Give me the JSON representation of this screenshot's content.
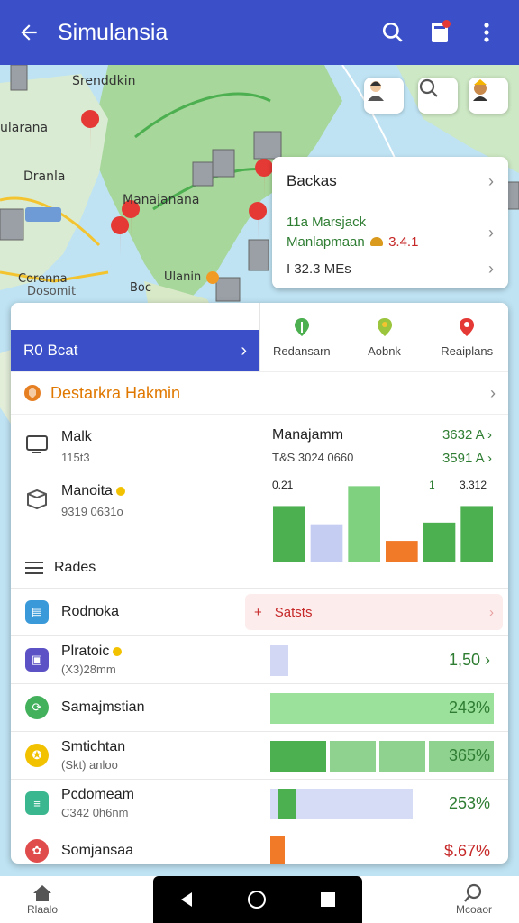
{
  "app": {
    "title": "Simulansia"
  },
  "map": {
    "labels": [
      "Srenddkin",
      "ularana",
      "Dranla",
      "Manajanana",
      "Corenna",
      "Dosomit",
      "Ulanin",
      "Boc"
    ],
    "chips": [
      "avatar-icon",
      "search-icon",
      "avatar2-icon"
    ]
  },
  "infocard": {
    "title": "Backas",
    "line1": "11a Marsjack",
    "line2": "Manlapmaan",
    "line2_val": "3.4.1",
    "line3": "I 32.3 MEs"
  },
  "panel": {
    "tab_active": "R0 Bcat",
    "tabs": [
      "Redansarn",
      "Aobnk",
      "Reaiplans"
    ],
    "section": "Destarkra Hakmin",
    "items": [
      {
        "name": "Malk",
        "sub": "115t3"
      },
      {
        "name": "Manoita",
        "sub": "9319 0631o"
      }
    ],
    "stats": {
      "title": "Manajamm",
      "sub": "T&S 3024 0660",
      "v1": "3632 A",
      "v2": "3591 A",
      "bar_labels": [
        "0.21",
        "1",
        "3.312"
      ]
    },
    "rates_label": "Rades",
    "rows": [
      {
        "name": "Rodnoka",
        "sub": "",
        "status": "Satsts",
        "value": ""
      },
      {
        "name": "Plratoic",
        "sub": "(X3)28mm",
        "value": "1,50"
      },
      {
        "name": "Samajmstian",
        "sub": "",
        "value": "243%"
      },
      {
        "name": "Smtichtan",
        "sub": "(Skt) anloo",
        "value": "365%"
      },
      {
        "name": "Pcdomeam",
        "sub": "C342 0h6nm",
        "value": "253%"
      },
      {
        "name": "Somjansaa",
        "sub": "",
        "value": "$.67%"
      }
    ]
  },
  "chart_data": {
    "type": "bar",
    "categories": [
      "1",
      "2",
      "3",
      "4",
      "5",
      "6"
    ],
    "values": [
      68,
      46,
      92,
      26,
      48,
      68
    ],
    "colors": [
      "#4caf50",
      "#c5cdf3",
      "#7fd07f",
      "#f07a28",
      "#4caf50",
      "#4caf50"
    ],
    "ylim": [
      0,
      100
    ]
  },
  "bottom_nav": {
    "left": "Rlaalo",
    "right": "Mcoaor"
  }
}
